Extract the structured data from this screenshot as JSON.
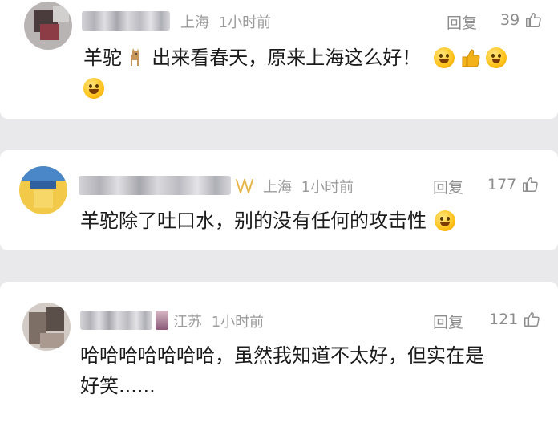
{
  "comments": [
    {
      "location": "上海",
      "time": "1小时前",
      "reply_label": "回复",
      "likes": "39",
      "text_before": "羊驼",
      "text_after": "出来看春天，原来上海这么好！"
    },
    {
      "location": "上海",
      "time": "1小时前",
      "reply_label": "回复",
      "likes": "177",
      "text": "羊驼除了吐口水，别的没有任何的攻击性"
    },
    {
      "location": "江苏",
      "time": "1小时前",
      "reply_label": "回复",
      "likes": "121",
      "text_line1": "哈哈哈哈哈哈哈，虽然我知道不太好，但实在是",
      "text_line2": "好笑......"
    }
  ],
  "icons": [
    "thumb-up-icon",
    "llama-emoji",
    "laugh-emoji",
    "clap-emoji",
    "sweat-smile-emoji",
    "vip-badge-icon"
  ],
  "colors": {
    "meta_gray": "#9b9b9b",
    "text": "#1b1b1b",
    "card": "#ffffff",
    "background": "#e9e9ec"
  }
}
